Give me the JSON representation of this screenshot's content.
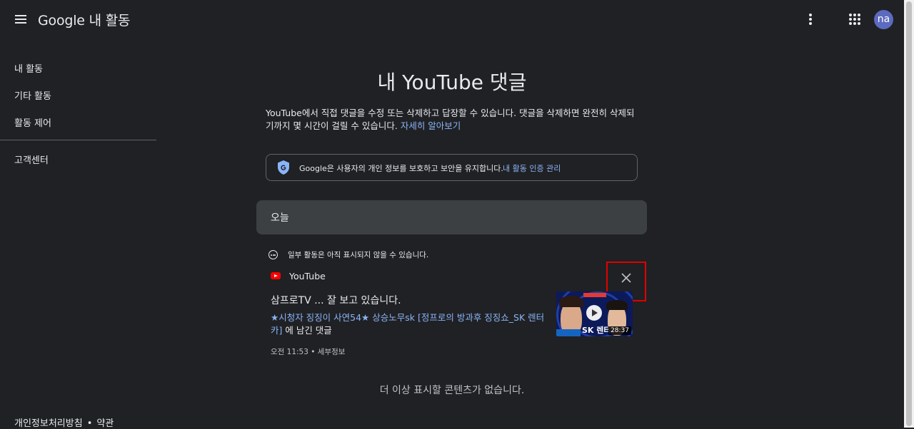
{
  "header": {
    "app_title": "Google 내 활동",
    "avatar_initials": "na",
    "avatar_color": "#5c6bc0",
    "icons": [
      "menu-icon",
      "more-vert-icon",
      "apps-icon"
    ]
  },
  "sidebar": {
    "items": [
      {
        "label": "내 활동"
      },
      {
        "label": "기타 활동"
      },
      {
        "label": "활동 제어"
      },
      {
        "label": "고객센터"
      }
    ],
    "footer": {
      "privacy": "개인정보처리방침",
      "separator": "•",
      "terms": "약관"
    }
  },
  "main": {
    "title": "내 YouTube 댓글",
    "description": "YouTube에서 직접 댓글을 수정 또는 삭제하고 답장할 수 있습니다. 댓글을 삭제하면 완전히 삭제되기까지 몇 시간이 걸릴 수 있습니다.",
    "learn_more": "자세히 알아보기",
    "privacy_notice": {
      "text": "Google은 사용자의 개인 정보를 보호하고 보안을 유지합니다.",
      "link": "내 활동 인증 관리"
    },
    "day_header": "오늘",
    "notice": "일부 활동은 아직 표시되지 않을 수 있습니다.",
    "activity": {
      "product": "YouTube",
      "comment": "삼프로TV ... 잘 보고 있습니다.",
      "video_title": "★시청자 징징이 사연54★ 상승노무sk [정프로의 방과후 징징쇼_SK 렌터카]",
      "video_suffix": " 에 남긴 댓글",
      "time": "오전 11:53",
      "separator": " • ",
      "detail": "세부정보",
      "duration": "28:37",
      "thumb_text": "SK 렌터"
    },
    "end_message": "더 이상 표시할 콘텐츠가 없습니다."
  },
  "colors": {
    "background": "#202124",
    "link": "#8ab4f8",
    "day_header_bg": "#3c4043",
    "highlight_box": "#e00000",
    "youtube_red": "#ff0000"
  }
}
